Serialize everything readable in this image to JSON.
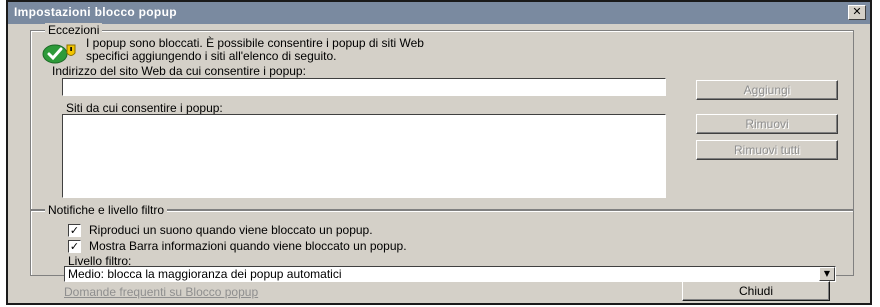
{
  "window": {
    "title": "Impostazioni blocco popup",
    "close_glyph": "✕"
  },
  "exceptions": {
    "legend": "Eccezioni",
    "icon": "shield-check-icon",
    "info_line1": "I popup sono bloccati. È possibile consentire i popup di siti Web",
    "info_line2": "specifici aggiungendo i siti all'elenco di seguito.",
    "address_label": "Indirizzo del sito Web da cui consentire i popup:",
    "address_value": "",
    "sites_label": "Siti da cui consentire i popup:",
    "sites": [],
    "add_label": "Aggiungi",
    "remove_label": "Rimuovi",
    "remove_all_label": "Rimuovi tutti"
  },
  "notifications": {
    "legend": "Notifiche e livello filtro",
    "play_sound_label": "Riproduci un suono quando viene bloccato un popup.",
    "play_sound_checked": true,
    "show_bar_label": "Mostra Barra informazioni quando viene bloccato un popup.",
    "show_bar_checked": true,
    "level_label": "Livello filtro:",
    "level_value": "Medio: blocca la maggioranza dei popup automatici"
  },
  "footer": {
    "faq_link": "Domande frequenti su Blocco popup",
    "close_label": "Chiudi"
  },
  "colors": {
    "dialog_bg": "#d4d0c8",
    "titlebar": "#7a8aa0",
    "icon_green": "#2e9a3a",
    "icon_yellow": "#f2c400"
  }
}
